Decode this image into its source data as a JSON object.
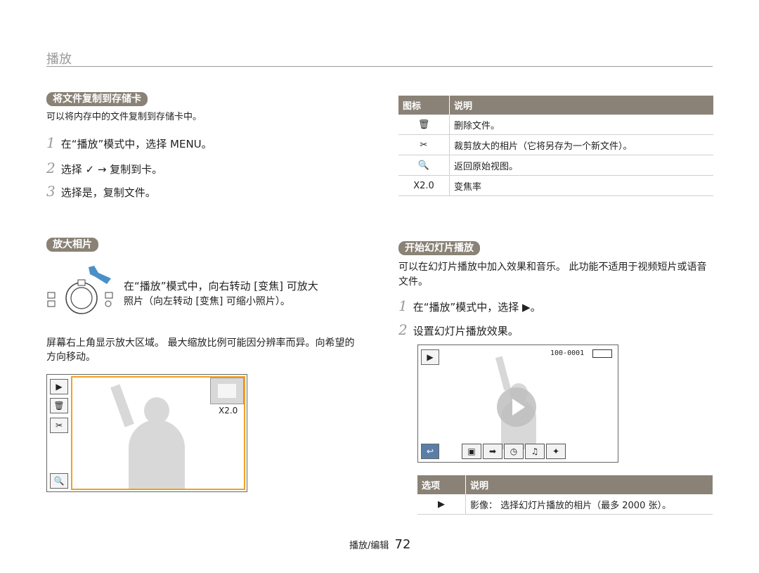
{
  "header": {
    "title": "播放"
  },
  "copy_section": {
    "heading": "将文件复制到存储卡",
    "intro": "可以将内存中的文件复制到存储卡中。",
    "steps": [
      {
        "num": "1",
        "text": "在“播放”模式中，选择 MENU。"
      },
      {
        "num": "2",
        "text": "选择 ✓ → 复制到卡。"
      },
      {
        "num": "3",
        "text": "选择是，复制文件。"
      }
    ]
  },
  "icon_table": {
    "headers": [
      "图标",
      "说明"
    ],
    "rows": [
      {
        "icon": "🗑",
        "desc": "删除文件。"
      },
      {
        "icon": "✂",
        "desc": "裁剪放大的相片（它将另存为一个新文件）。"
      },
      {
        "icon": "🔍",
        "desc": "返回原始视图。"
      },
      {
        "icon": "X2.0",
        "desc": "变焦率"
      }
    ]
  },
  "zoom_section": {
    "heading": "放大相片",
    "line1": "在“播放”模式中，向右转动 [变焦] 可放大",
    "line2": "照片（向左转动 [变焦] 可缩小照片）。",
    "note": "屏幕右上角显示放大区域。 最大缩放比例可能因分辨率而异。向希望的方向移动。",
    "screen_zoom": "X2.0"
  },
  "slideshow_section": {
    "heading": "开始幻灯片播放",
    "intro": "可以在幻灯片播放中加入效果和音乐。 此功能不适用于视频短片或语音文件。",
    "steps": [
      {
        "num": "1",
        "text": "在“播放”模式中，选择 ▶。"
      },
      {
        "num": "2",
        "text": "设置幻灯片播放效果。"
      }
    ],
    "file_number": "100-0001",
    "options_table": {
      "headers": [
        "选项",
        "说明"
      ],
      "rows": [
        {
          "icon": "▶",
          "desc": "影像： 选择幻灯片播放的相片（最多 2000 张）。"
        }
      ]
    }
  },
  "footer": {
    "section": "播放/编辑",
    "page": "72"
  }
}
